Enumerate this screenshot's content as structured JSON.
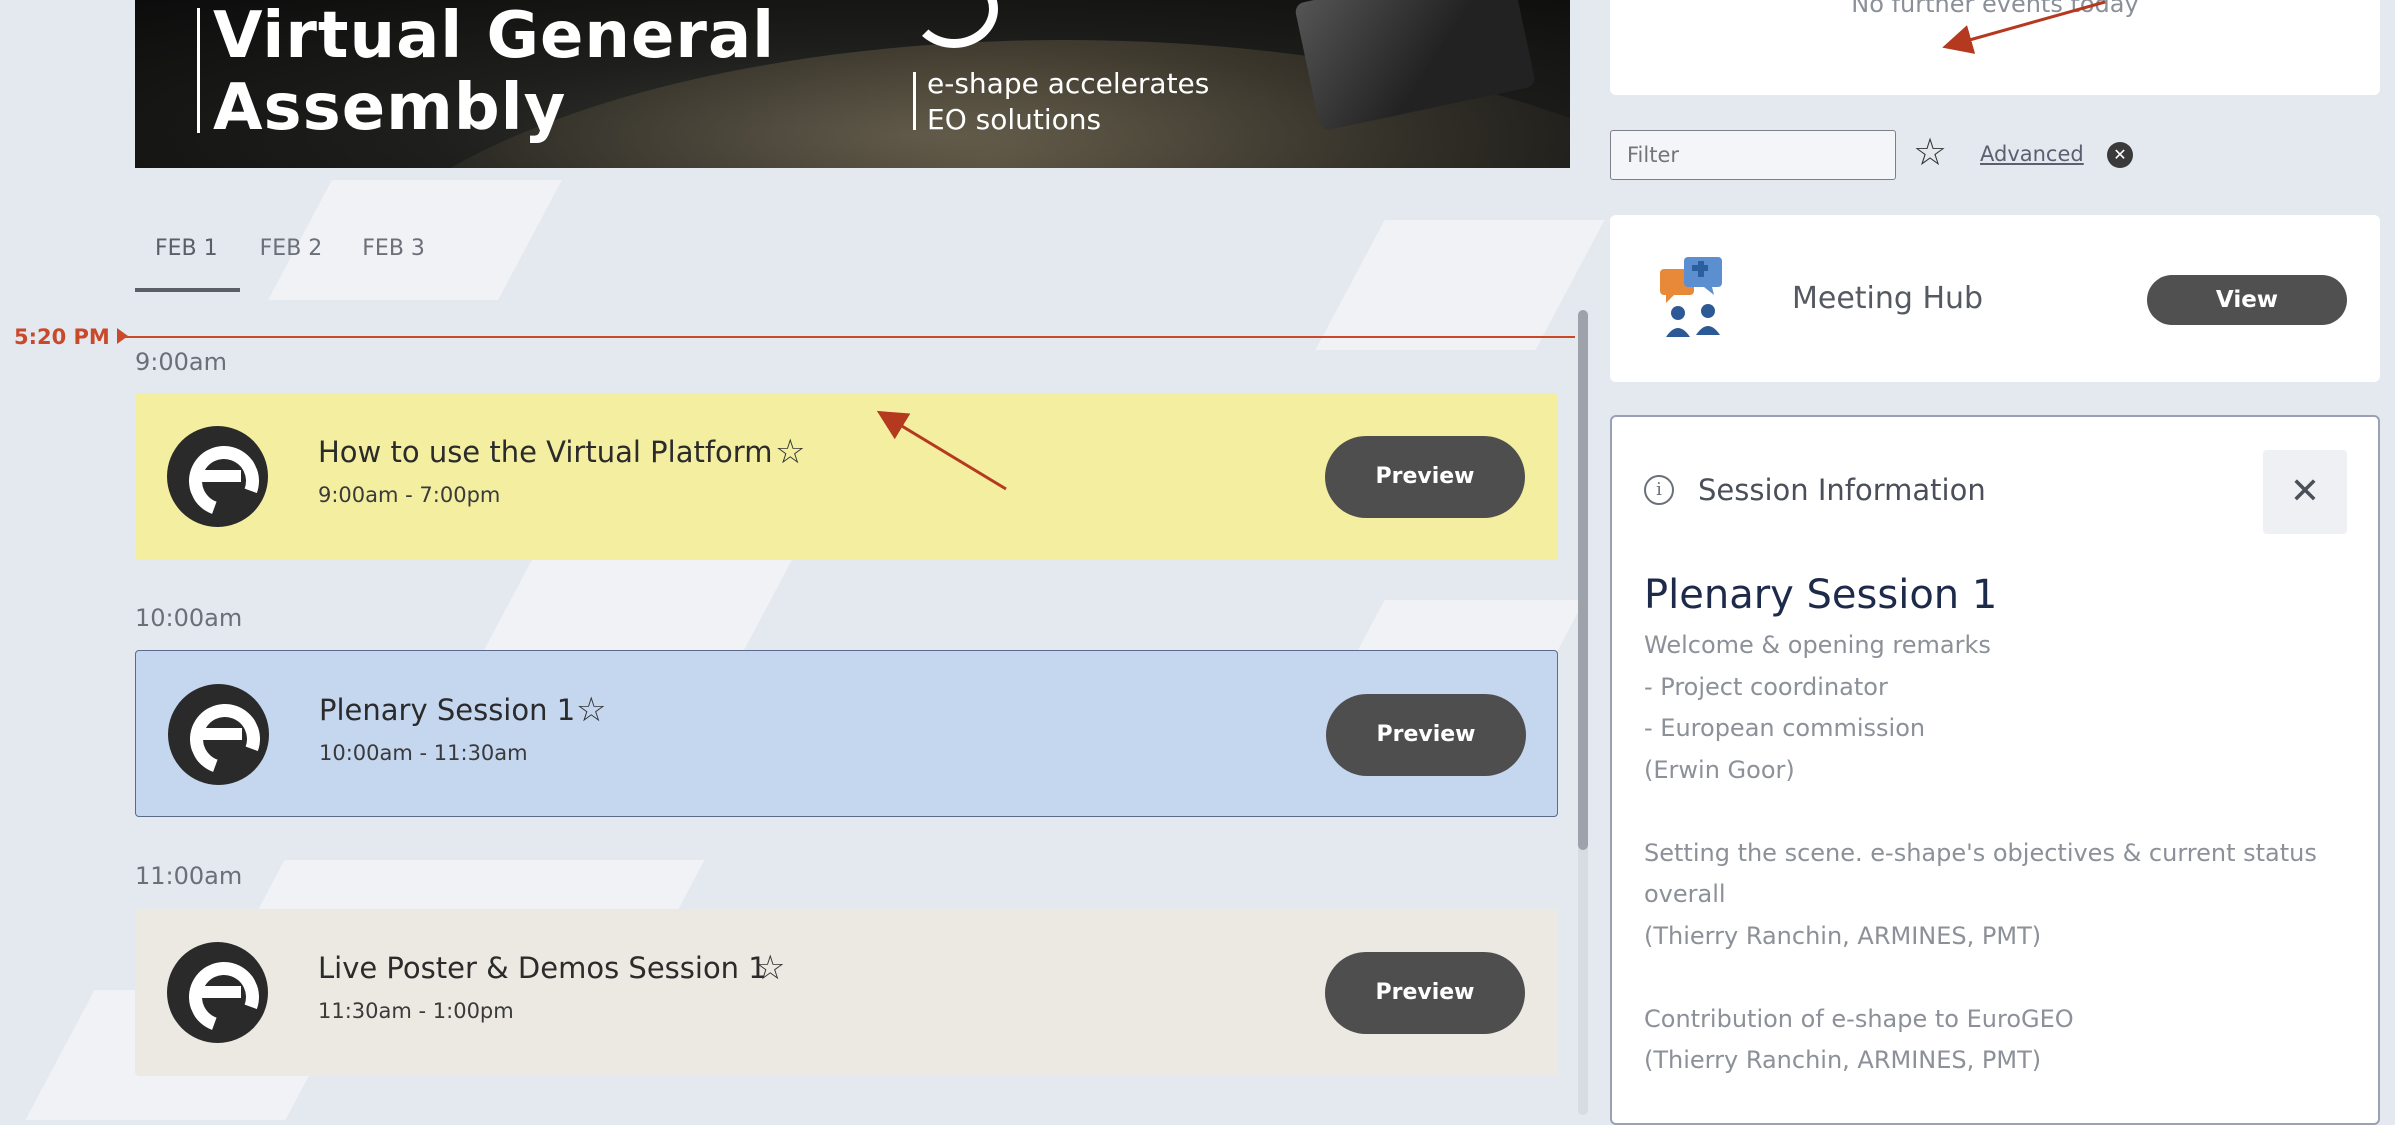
{
  "banner": {
    "title_line1": "Virtual General",
    "title_line2": "Assembly",
    "tagline_line1": "e-shape accelerates",
    "tagline_line2": "EO solutions"
  },
  "tabs": [
    {
      "label": "FEB 1",
      "active": true
    },
    {
      "label": "FEB 2",
      "active": false
    },
    {
      "label": "FEB 3",
      "active": false
    }
  ],
  "current_time": "5:20 PM",
  "timeline": [
    {
      "time_label": "9:00am",
      "session": {
        "name": "How to use the Virtual Platform",
        "times": "9:00am - 7:00pm",
        "button": "Preview",
        "color": "#f3eea0"
      }
    },
    {
      "time_label": "10:00am",
      "session": {
        "name": "Plenary Session 1",
        "times": "10:00am - 11:30am",
        "button": "Preview",
        "color": "#c5d6ef"
      }
    },
    {
      "time_label": "11:00am",
      "session": {
        "name": "Live Poster & Demos Session 1",
        "times": "11:30am - 1:00pm",
        "button": "Preview",
        "color": "#ece9e2"
      }
    }
  ],
  "sidebar": {
    "no_events_text": "No further events today",
    "filter_placeholder": "Filter",
    "advanced_label": "Advanced",
    "meeting_hub": {
      "label": "Meeting Hub",
      "button": "View"
    },
    "session_info": {
      "header": "Session Information",
      "title": "Plenary Session 1",
      "description_lines": [
        "Welcome & opening remarks",
        "- Project coordinator",
        "- European commission",
        "(Erwin Goor)",
        "",
        "Setting the scene. e-shape's objectives & current status",
        "overall",
        "(Thierry Ranchin, ARMINES, PMT)",
        "",
        "Contribution of e-shape to EuroGEO",
        "(Thierry Ranchin, ARMINES, PMT)"
      ]
    }
  },
  "colors": {
    "accent_red": "#c9492b",
    "button_dark": "#4e4e4e",
    "annotation_arrow": "#b5391f"
  }
}
